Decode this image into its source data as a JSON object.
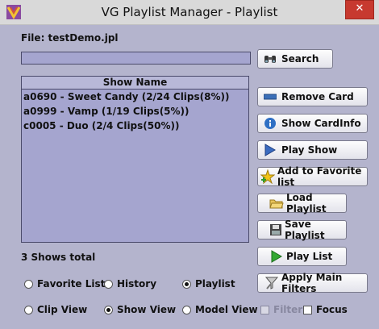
{
  "window": {
    "title": "VG Playlist Manager - Playlist",
    "close_glyph": "✕"
  },
  "file": {
    "label": "File: testDemo.jpl"
  },
  "search": {
    "value": "",
    "button_label": "Search"
  },
  "list": {
    "header": "Show Name",
    "items": [
      "a0690 - Sweet Candy (2/24 Clips(8%))",
      "a0999 - Vamp (1/19 Clips(5%))",
      "c0005 - Duo (2/4 Clips(50%))"
    ],
    "total_label": "3 Shows total"
  },
  "buttons": {
    "remove_card": "Remove Card",
    "show_cardinfo": "Show CardInfo",
    "play_show": "Play Show",
    "add_favorite": "Add to Favorite list",
    "load_playlist": "Load Playlist",
    "save_playlist": "Save Playlist",
    "play_list": "Play List",
    "apply_filters": "Apply Main Filters"
  },
  "options": {
    "favorite_list": "Favorite List",
    "history": "History",
    "playlist": "Playlist",
    "clip_view": "Clip View",
    "show_view": "Show View",
    "model_view": "Model View",
    "filter": "Filter",
    "focus": "Focus",
    "selected_list_mode": "Playlist",
    "selected_view_mode": "Show View"
  },
  "icons": {
    "app": "app-logo-icon",
    "search": "binoculars-icon",
    "remove": "minus-bar-icon",
    "info": "info-icon",
    "play_show": "play-icon",
    "favorite": "star-add-icon",
    "load": "folder-open-icon",
    "save": "floppy-disk-icon",
    "play_list": "green-play-icon",
    "filters": "filter-tool-icon"
  },
  "colors": {
    "background": "#b4b4cd",
    "list_bg": "#a5a5cf",
    "close_red": "#c7392f"
  }
}
